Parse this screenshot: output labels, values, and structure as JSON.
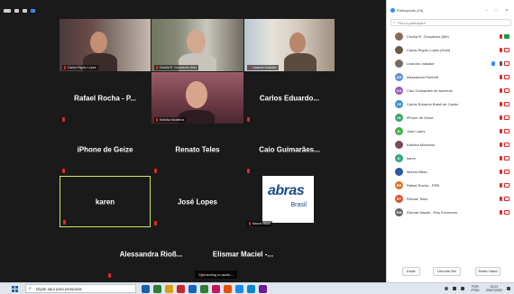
{
  "gallery": {
    "video_tiles": [
      {
        "name": "Carlos Rigolo Lopes"
      },
      {
        "name": "Cecília R. Gonçalves (Me)"
      },
      {
        "name": "Lisandro Inakake"
      },
      {
        "name": "Karinka Modeiros"
      },
      {
        "name": "Marcio Milan"
      }
    ],
    "name_tiles": [
      {
        "name": "Rafael Rocha - P..."
      },
      {
        "name": "Carlos Eduardo..."
      },
      {
        "name": "iPhone de Geize"
      },
      {
        "name": "Renato Teles"
      },
      {
        "name": "Caio Guimarães..."
      },
      {
        "name": "karen"
      },
      {
        "name": "José Lopes"
      },
      {
        "name": "Alessandra Rioß..."
      },
      {
        "name": "Elismar Maciel -..."
      }
    ],
    "logo": {
      "word": "abras",
      "sub": "Brasil"
    },
    "connecting": "Connecting to audio..."
  },
  "panel": {
    "title": "Participants (19)",
    "controls": [
      "–",
      "□",
      "✕"
    ],
    "search_placeholder": "Find a participant",
    "participants": [
      {
        "name": "Cecília R. Gonçalves (Me)",
        "initials": "",
        "color": "#8a6a5a",
        "mic": "muted",
        "video": "on"
      },
      {
        "name": "Carlos Rigolo Lopes (Host)",
        "initials": "",
        "color": "#6a5a4a",
        "mic": "muted",
        "video": "off"
      },
      {
        "name": "Lisandro Inakake",
        "initials": "",
        "color": "#7a6a60",
        "mic": "on",
        "video": "off",
        "hand": true
      },
      {
        "name": "Alessandra Rioßeiff",
        "initials": "AR",
        "color": "#5e8fcf",
        "mic": "muted",
        "video": "off"
      },
      {
        "name": "Caio Guimarães de Azevedo",
        "initials": "CG",
        "color": "#9b59b6",
        "mic": "muted",
        "video": "off"
      },
      {
        "name": "Carlos Eduardo Brasil de Castro",
        "initials": "CE",
        "color": "#3a8fd0",
        "mic": "muted",
        "video": "off"
      },
      {
        "name": "iPhone de Geize",
        "initials": "iG",
        "color": "#3aa86b",
        "mic": "muted",
        "video": "off"
      },
      {
        "name": "José Lopes",
        "initials": "JL",
        "color": "#46b04a",
        "mic": "muted",
        "video": "off"
      },
      {
        "name": "Karinka Modeiros",
        "initials": "",
        "color": "#7a4a5a",
        "mic": "muted",
        "video": "off"
      },
      {
        "name": "karen",
        "initials": "K",
        "color": "#2fa88a",
        "mic": "muted",
        "video": "off"
      },
      {
        "name": "Marcio Milan",
        "initials": "",
        "color": "#2a5a9a",
        "mic": "muted",
        "video": "off"
      },
      {
        "name": "Rafael Rocha - PRB",
        "initials": "RR",
        "color": "#e07020",
        "mic": "muted",
        "video": "off"
      },
      {
        "name": "Renato Teles",
        "initials": "RT",
        "color": "#d9532c",
        "mic": "muted",
        "video": "off"
      },
      {
        "name": "Elismar Maciel - Rep Enviromm",
        "initials": "EM",
        "color": "#5a5f66",
        "mic": "muted",
        "video": "off"
      }
    ],
    "footer": {
      "invite": "Invite",
      "unmute": "Unmute Me",
      "raise_hand": "Raise Hand"
    }
  },
  "taskbar": {
    "search_placeholder": "Digite aqui para pesquisar",
    "apps": [
      "#1b5fa8",
      "#2e7d32",
      "#d4a017",
      "#c62828",
      "#1565c0",
      "#2e7d32",
      "#c2185b",
      "#e65100",
      "#1e88e5",
      "#0288d1",
      "#6a1b9a"
    ],
    "lang": "POR PTB2",
    "time": "15:21",
    "date": "09/07/2020"
  }
}
